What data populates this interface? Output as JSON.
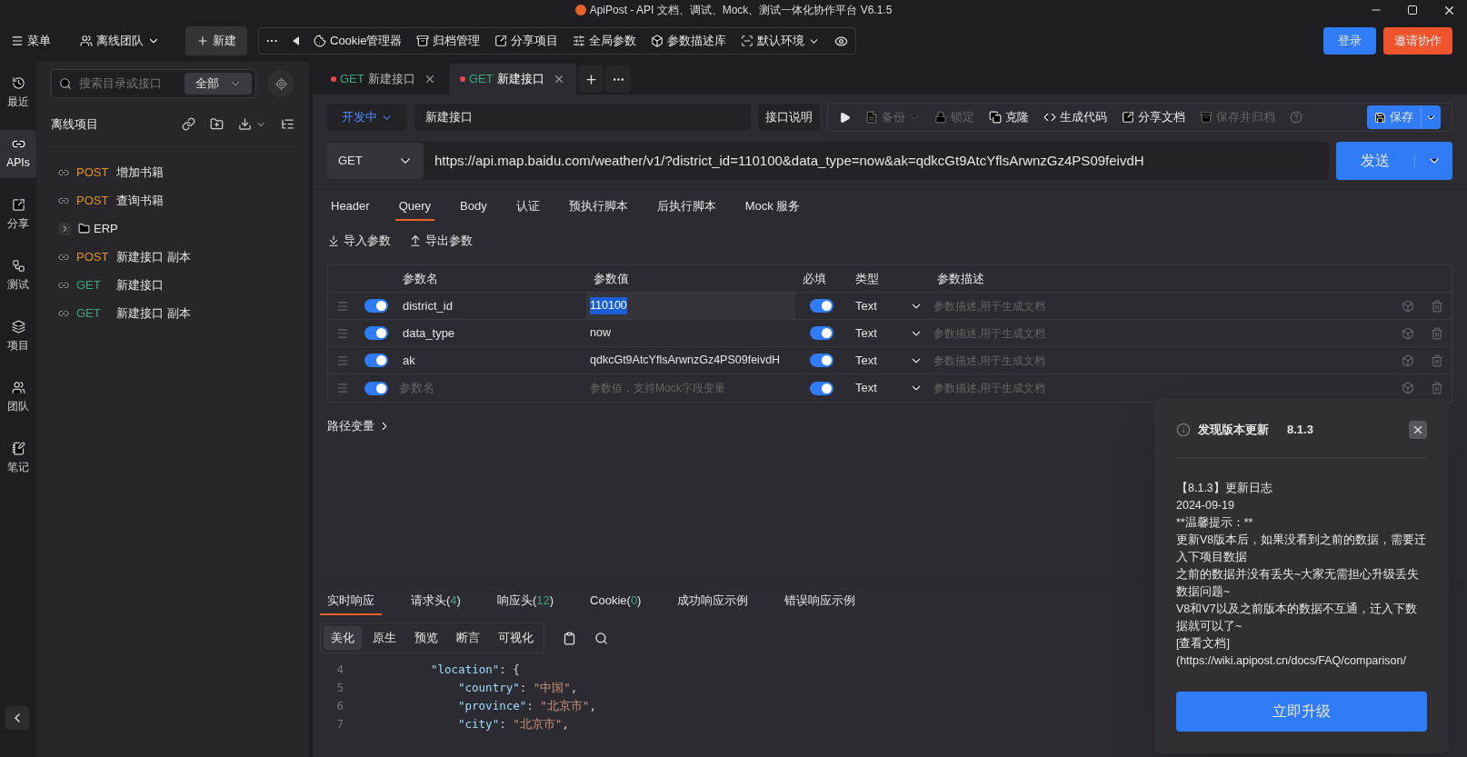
{
  "window": {
    "title": "ApiPost - API 文档、调试、Mock、测试一体化协作平台 V6.1.5"
  },
  "topbar": {
    "menu": "菜单",
    "team": "离线团队",
    "new": "新建",
    "more": "···",
    "tools": [
      {
        "kind": "cookie",
        "label": "Cookie管理器"
      },
      {
        "kind": "archive",
        "label": "归档管理"
      },
      {
        "kind": "share",
        "label": "分享项目"
      },
      {
        "kind": "params",
        "label": "全局参数"
      },
      {
        "kind": "box",
        "label": "参数描述库"
      },
      {
        "kind": "env",
        "label": "默认环境"
      }
    ],
    "login": "登录",
    "invite": "邀请协作"
  },
  "nav": [
    {
      "kind": "recent",
      "label": "最近",
      "selected": false
    },
    {
      "kind": "apis",
      "label": "APIs",
      "selected": true
    },
    {
      "kind": "share",
      "label": "分享",
      "selected": false
    },
    {
      "kind": "test",
      "label": "测试",
      "selected": false
    },
    {
      "kind": "project",
      "label": "项目",
      "selected": false
    },
    {
      "kind": "team",
      "label": "团队",
      "selected": false
    },
    {
      "kind": "note",
      "label": "笔记",
      "selected": false
    }
  ],
  "sidebar": {
    "search": {
      "placeholder": "搜索目录或接口"
    },
    "filter": "全部",
    "project": "离线项目",
    "tree": [
      {
        "kind": "api",
        "method": "POST",
        "color": "#e0902f",
        "name": "增加书籍"
      },
      {
        "kind": "api",
        "method": "POST",
        "color": "#e0902f",
        "name": "查询书籍"
      },
      {
        "kind": "folder",
        "name": "ERP",
        "expanded": false
      },
      {
        "kind": "api",
        "method": "POST",
        "color": "#e0902f",
        "name": "新建接口 副本"
      },
      {
        "kind": "api",
        "method": "GET",
        "color": "#3ba67a",
        "name": "新建接口"
      },
      {
        "kind": "api",
        "method": "GET",
        "color": "#3ba67a",
        "name": "新建接口 副本"
      }
    ]
  },
  "open_tabs": [
    {
      "method": "GET",
      "color": "#3ba67a",
      "name": "新建接口",
      "unsaved": true,
      "selected": false
    },
    {
      "method": "GET",
      "color": "#3ba67a",
      "name": "新建接口",
      "unsaved": true,
      "selected": true
    }
  ],
  "request": {
    "status": "开发中",
    "name": "新建接口",
    "doc_button": "接口说明",
    "actions": [
      {
        "kind": "backup",
        "label": "备份",
        "disabled": true
      },
      {
        "kind": "lock",
        "label": "锁定",
        "disabled": true
      },
      {
        "kind": "clone",
        "label": "克隆",
        "disabled": false
      },
      {
        "kind": "code",
        "label": "生成代码",
        "disabled": false
      },
      {
        "kind": "share",
        "label": "分享文档",
        "disabled": false
      },
      {
        "kind": "archive",
        "label": "保存并归档",
        "disabled": true
      }
    ],
    "save": "保存",
    "method": "GET",
    "url": "https://api.map.baidu.com/weather/v1/?district_id=110100&data_type=now&ak=qdkcGt9AtcYflsArwnzGz4PS09feivdH",
    "send": "发送"
  },
  "request_tabs": [
    {
      "label": "Header",
      "selected": false
    },
    {
      "label": "Query",
      "selected": true
    },
    {
      "label": "Body",
      "selected": false
    },
    {
      "label": "认证",
      "selected": false
    },
    {
      "label": "预执行脚本",
      "selected": false
    },
    {
      "label": "后执行脚本",
      "selected": false
    },
    {
      "label": "Mock 服务",
      "selected": false
    }
  ],
  "param_actions": [
    {
      "kind": "import",
      "label": "导入参数"
    },
    {
      "kind": "export",
      "label": "导出参数"
    }
  ],
  "params": {
    "columns": [
      "参数名",
      "参数值",
      "必填",
      "类型",
      "参数描述"
    ],
    "rows": [
      {
        "enabled": true,
        "name": "district_id",
        "value": "110100",
        "value_selected": true,
        "required": true,
        "type": "Text",
        "description": {
          "placeholder": "参数描述,用于生成文档"
        }
      },
      {
        "enabled": true,
        "name": "data_type",
        "value": "now",
        "value_selected": false,
        "required": true,
        "type": "Text",
        "description": {
          "placeholder": "参数描述,用于生成文档"
        }
      },
      {
        "enabled": true,
        "name": "ak",
        "value": "qdkcGt9AtcYflsArwnzGz4PS09feivdH",
        "value_selected": false,
        "required": true,
        "type": "Text",
        "description": {
          "placeholder": "参数描述,用于生成文档"
        }
      },
      {
        "enabled": true,
        "name_field": {
          "placeholder": "参数名"
        },
        "value_field": {
          "placeholder": "参数值，支持Mock字段变量"
        },
        "required": true,
        "type": "Text",
        "description": {
          "placeholder": "参数描述,用于生成文档"
        }
      }
    ]
  },
  "path_variables": {
    "label": "路径变量",
    "expanded": false
  },
  "response": {
    "tabs": [
      {
        "label": "实时响应",
        "selected": true
      },
      {
        "label": "请求头(",
        "count": "4",
        "close": ")",
        "selected": false
      },
      {
        "label": "响应头(",
        "count": "12",
        "close": ")",
        "selected": false
      },
      {
        "label": "Cookie(",
        "count": "0",
        "close": ")",
        "selected": false
      },
      {
        "label": "成功响应示例",
        "selected": false
      },
      {
        "label": "错误响应示例",
        "selected": false
      }
    ],
    "views": [
      {
        "label": "美化",
        "selected": true
      },
      {
        "label": "原生",
        "selected": false
      },
      {
        "label": "预览",
        "selected": false
      },
      {
        "label": "断言",
        "selected": false
      },
      {
        "label": "可视化",
        "selected": false
      }
    ],
    "code": [
      {
        "no": "4",
        "tokens": [
          {
            "kind": "key",
            "text": "\"location\""
          },
          {
            "kind": "punct",
            "text": ": {"
          }
        ],
        "children": [
          {
            "no": "5",
            "tokens": [
              {
                "kind": "key",
                "text": "\"country\""
              },
              {
                "kind": "punct",
                "text": ": "
              },
              {
                "kind": "string",
                "text": "\"中国\""
              },
              {
                "kind": "punct",
                "text": ","
              }
            ]
          },
          {
            "no": "6",
            "tokens": [
              {
                "kind": "key",
                "text": "\"province\""
              },
              {
                "kind": "punct",
                "text": ": "
              },
              {
                "kind": "string",
                "text": "\"北京市\""
              },
              {
                "kind": "punct",
                "text": ","
              }
            ]
          },
          {
            "no": "7",
            "tokens": [
              {
                "kind": "key",
                "text": "\"city\""
              },
              {
                "kind": "punct",
                "text": ": "
              },
              {
                "kind": "string",
                "text": "\"北京市\""
              },
              {
                "kind": "punct",
                "text": ","
              }
            ]
          }
        ]
      }
    ]
  },
  "update_dialog": {
    "title": "发现版本更新",
    "version": "8.1.3",
    "lines": [
      "【8.1.3】更新日志",
      "2024-09-19",
      "**温馨提示：**",
      "更新V8版本后，如果没看到之前的数据，需要迁入下项目数据",
      "之前的数据并没有丢失~大家无需担心升级丢失数据问题~",
      "V8和V7以及之前版本的数据不互通，迁入下数据就可以了~",
      "[查看文档]",
      "(https://wiki.apipost.cn/docs/FAQ/comparison/"
    ],
    "button": "立即升级"
  }
}
